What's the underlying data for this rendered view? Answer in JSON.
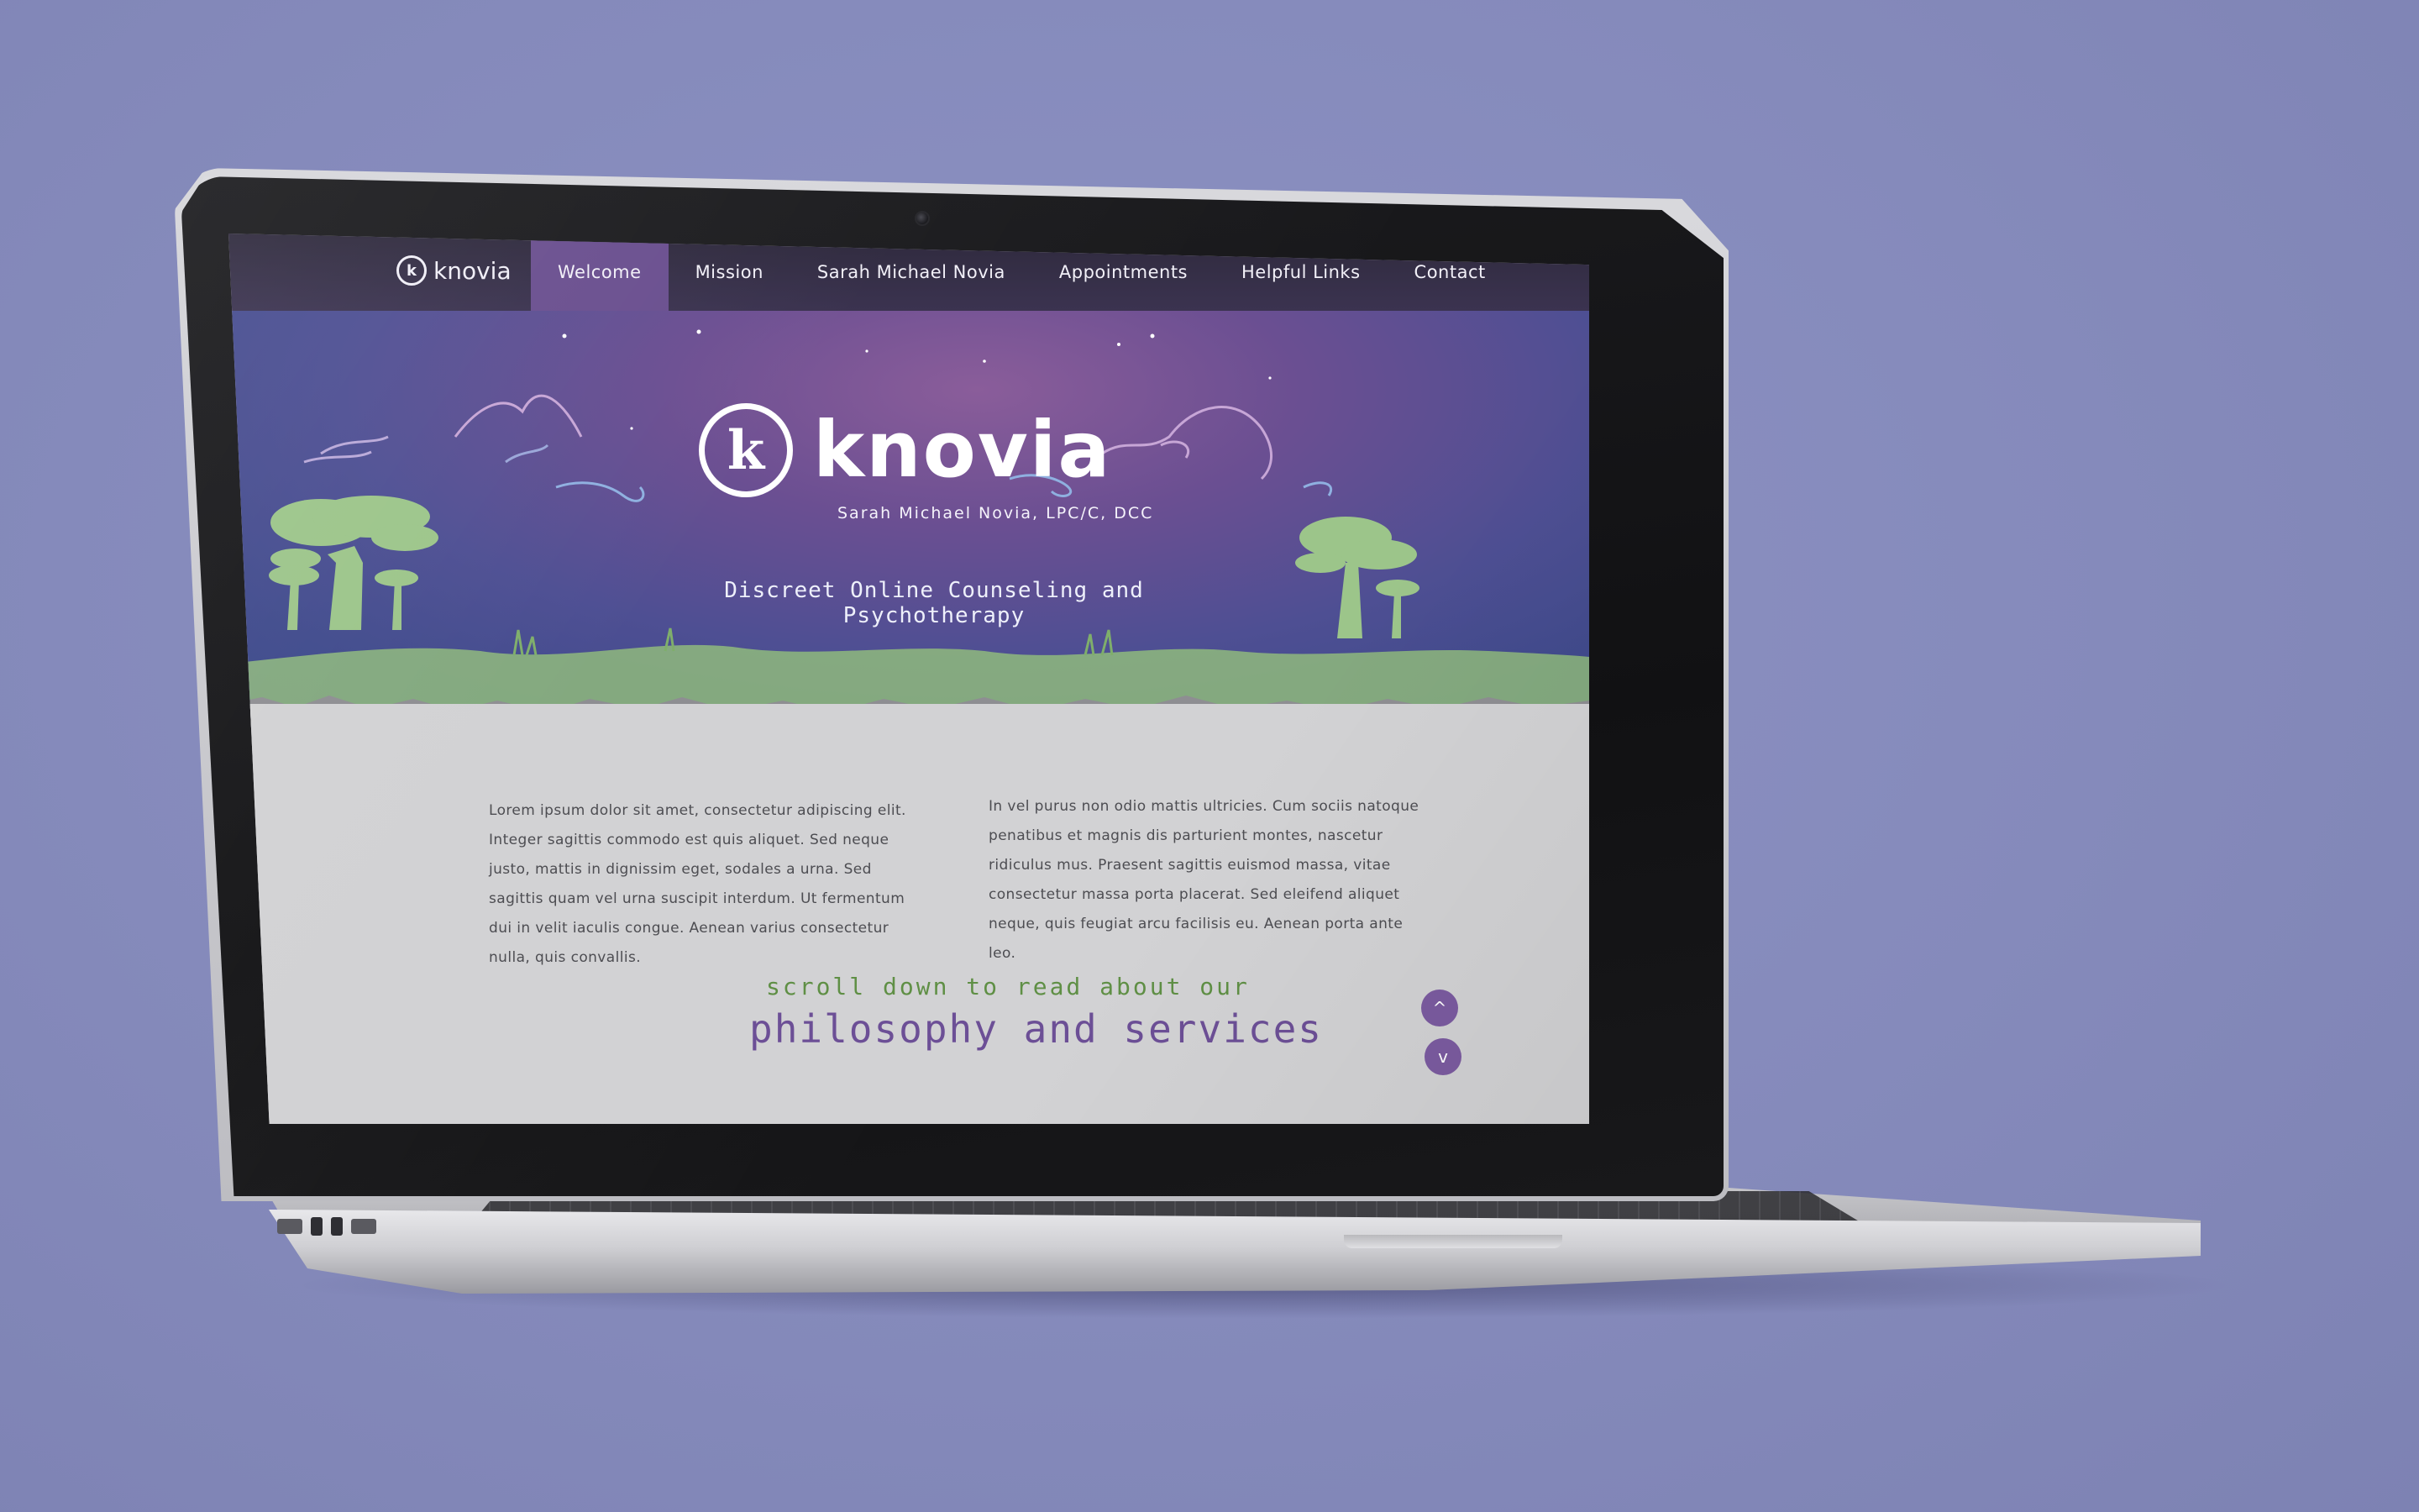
{
  "nav": {
    "logo_text": "knovia",
    "items": [
      {
        "label": "Welcome",
        "active": true
      },
      {
        "label": "Mission",
        "active": false
      },
      {
        "label": "Sarah Michael Novia",
        "active": false
      },
      {
        "label": "Appointments",
        "active": false
      },
      {
        "label": "Helpful Links",
        "active": false
      },
      {
        "label": "Contact",
        "active": false
      }
    ]
  },
  "hero": {
    "wordmark": "knovia",
    "logo_letter": "k",
    "subtitle": "Sarah Michael Novia, LPC/C, DCC",
    "tagline": "Discreet Online Counseling and Psychotherapy"
  },
  "content": {
    "left_paragraph": "Lorem ipsum dolor sit amet, consectetur adipiscing elit. Integer sagittis commodo est quis aliquet. Sed neque justo, mattis in dignissim eget, sodales a urna. Sed sagittis quam vel urna suscipit interdum. Ut fermentum dui in velit iaculis congue. Aenean varius consectetur nulla, quis convallis.",
    "right_paragraph": "In vel purus non odio mattis ultricies. Cum sociis natoque penatibus et magnis dis parturient montes, nascetur ridiculus mus. Praesent sagittis euismod massa, vitae consectetur massa porta placerat. Sed eleifend aliquet neque, quis feugiat arcu facilisis eu. Aenean porta ante leo.",
    "scroll_hint": "scroll down to read about our",
    "scroll_title": "philosophy and services"
  },
  "controls": {
    "up_icon": "chevron-up-icon",
    "down_icon": "chevron-down-icon",
    "up_glyph": "^",
    "down_glyph": "v"
  },
  "colors": {
    "background": "#868bbd",
    "nav_bg": "#2f2a3d",
    "nav_active": "#6a4f8f",
    "hero_top": "#8a5d9a",
    "hero_bottom": "#3f4a8c",
    "paper": "#d2d2d4",
    "accent_green": "#5f8f45",
    "accent_purple": "#6c4f96",
    "button_purple": "#7b5ba0",
    "tree_green": "#9cc58a"
  }
}
